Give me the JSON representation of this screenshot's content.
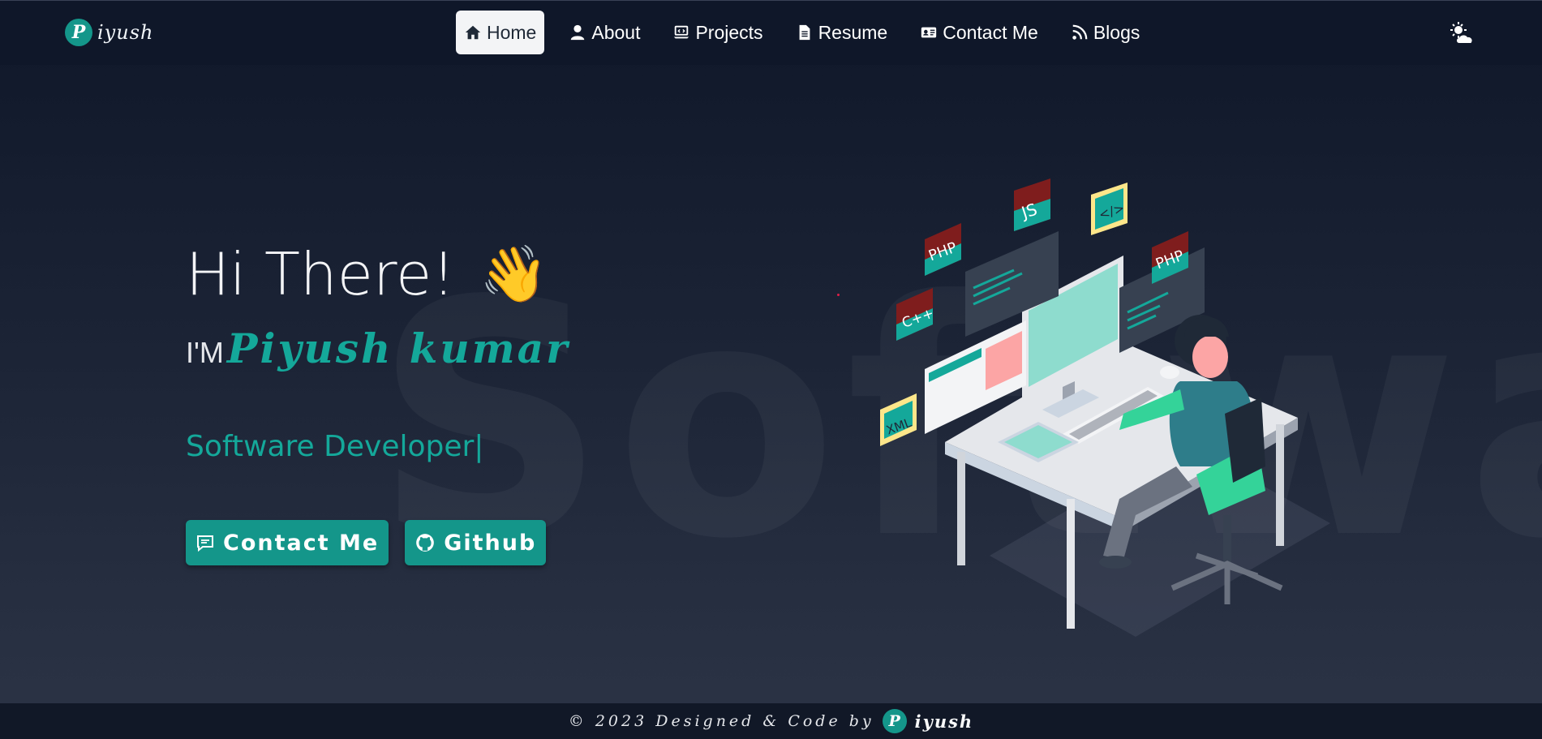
{
  "navbar": {
    "brand_logo_letter": "P",
    "brand_text": "iyush",
    "links": [
      {
        "label": "Home",
        "icon": "home-icon",
        "active": true
      },
      {
        "label": "About",
        "icon": "user-icon",
        "active": false
      },
      {
        "label": "Projects",
        "icon": "laptop-code-icon",
        "active": false
      },
      {
        "label": "Resume",
        "icon": "file-icon",
        "active": false
      },
      {
        "label": "Contact Me",
        "icon": "id-card-icon",
        "active": false
      },
      {
        "label": "Blogs",
        "icon": "rss-icon",
        "active": false
      }
    ],
    "theme_toggle_icon": "sun-cloud-icon"
  },
  "hero": {
    "greeting": "Hi There!",
    "wave_emoji": "👋",
    "intro_prefix": "I'M",
    "name": "Piyush kumar",
    "role": "Software Developer",
    "cursor": "|",
    "background_word": "Software",
    "buttons": {
      "contact_label": "Contact Me",
      "github_label": "Github"
    }
  },
  "illustration": {
    "tiles": [
      "PHP",
      "JS",
      "</>",
      "PHP",
      "C++",
      "XML"
    ]
  },
  "footer": {
    "text": "© 2023 Designed & Code by",
    "logo_letter": "P",
    "brand": "iyush"
  },
  "colors": {
    "accent": "#14968a",
    "accent_text": "#14a89a",
    "navbar_bg": "#0f1729",
    "footer_bg": "#111827"
  }
}
